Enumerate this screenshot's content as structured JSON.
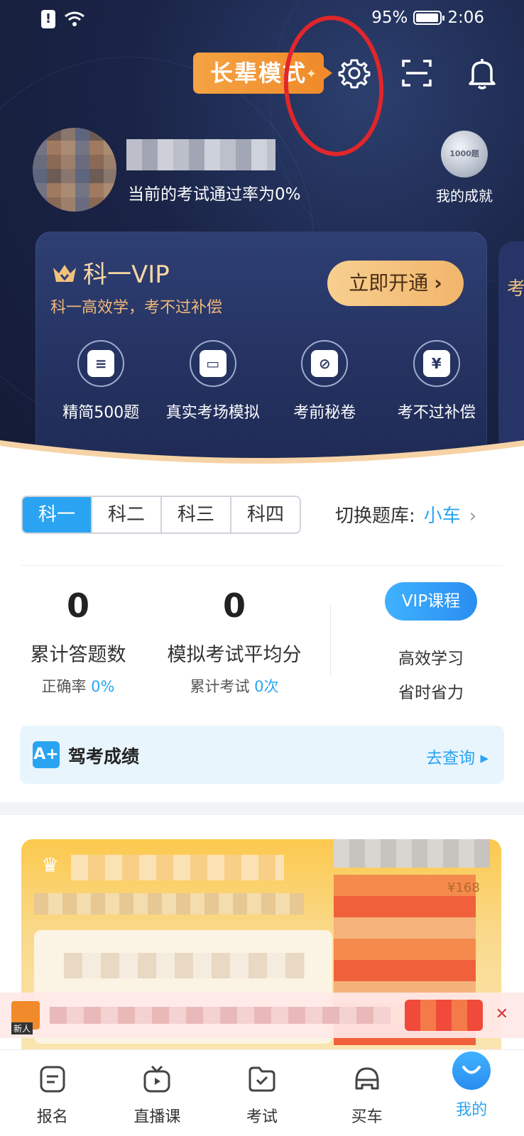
{
  "status_bar": {
    "battery": "95%",
    "time": "2:06"
  },
  "header": {
    "elder_mode": "长辈模式",
    "pass_rate_text": "当前的考试通过率为0%",
    "achievement": {
      "medal_text": "1000题",
      "label": "我的成就"
    }
  },
  "vip_card": {
    "title": "科一VIP",
    "subtitle": "科一高效学，考不过补偿",
    "button": "立即开通",
    "features": [
      {
        "label": "精简500题",
        "icon": "document-icon"
      },
      {
        "label": "真实考场模拟",
        "icon": "monitor-icon"
      },
      {
        "label": "考前秘卷",
        "icon": "clipboard-icon"
      },
      {
        "label": "考不过补偿",
        "icon": "yen-ticket-icon"
      }
    ],
    "peek_text": "考"
  },
  "subject_tabs": [
    "科一",
    "科二",
    "科三",
    "科四"
  ],
  "switch_bank": {
    "label": "切换题库:",
    "value": "小车"
  },
  "stats": {
    "answered": {
      "value": "0",
      "label": "累计答题数",
      "sub_prefix": "正确率",
      "sub_value": "0%"
    },
    "mock_avg": {
      "value": "0",
      "label": "模拟考试平均分",
      "sub_prefix": "累计考试",
      "sub_value": "0次"
    }
  },
  "course": {
    "button": "VIP课程",
    "line1": "高效学习",
    "line2": "省时省力"
  },
  "score_banner": {
    "badge": "A+",
    "title": "驾考成绩",
    "link": "去查询"
  },
  "promo": {
    "price_hint": "¥168",
    "new_tag": "新人"
  },
  "bottom_nav": [
    "报名",
    "直播课",
    "考试",
    "买车",
    "我的"
  ],
  "colors": {
    "accent": "#2aa4f2",
    "header_bg": "#1a2447",
    "elder_badge": "#f08a2a",
    "annotation": "#e1262b"
  }
}
